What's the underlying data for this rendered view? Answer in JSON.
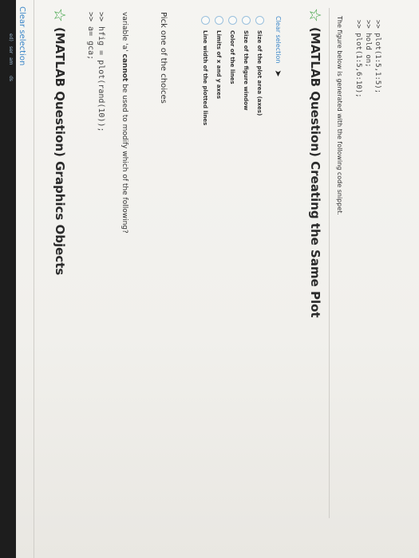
{
  "top_link": "Clear selection",
  "question1": {
    "title": "(MATLAB Question) Graphics Objects",
    "code": [
      ">> hfig = plot(rand(10));",
      ">> a= gca;"
    ],
    "prompt_prefix": "variable 'a' ",
    "prompt_bold": "cannot",
    "prompt_suffix": " be used to modify which of the following?",
    "pick_label": "Pick one of the choices",
    "choices": [
      "Line width of the plotted lines",
      "Limits of x and y axes",
      "Color of the lines",
      "Size of the figure window",
      "Size of the plot area (axes)"
    ],
    "clear_label": "Clear selection"
  },
  "question2": {
    "title": "(MATLAB Question) Creating the Same Plot",
    "description": "The figure below is generated with the following code snippet.",
    "code": [
      ">> plot(1:5,1:5);",
      ">> hold on;",
      ">> plot(1:5,6:10);"
    ]
  },
  "left_edge_labels": [
    "ds",
    "am",
    "ser",
    "ed)"
  ],
  "colors": {
    "accent_link": "#3a86c8",
    "star": "#3aa040",
    "radio_border": "#9ac0dd"
  }
}
